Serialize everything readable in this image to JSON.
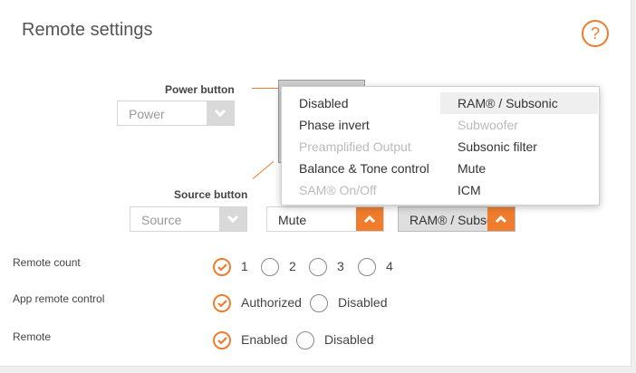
{
  "page": {
    "title": "Remote settings",
    "help_glyph": "?"
  },
  "colors": {
    "accent": "#f07c2e",
    "panel": "#ffffff",
    "border": "#d5d5d5"
  },
  "power": {
    "label": "Power button",
    "select_value": "Power"
  },
  "source": {
    "label": "Source button",
    "select_value": "Source",
    "mute_value": "Mute",
    "ram_value": "RAM® / Subsonic"
  },
  "dropdown": {
    "left_items": [
      {
        "label": "Disabled",
        "disabled": false
      },
      {
        "label": "Phase invert",
        "disabled": false
      },
      {
        "label": "Preamplified Output",
        "disabled": true
      },
      {
        "label": "Balance & Tone control",
        "disabled": false
      },
      {
        "label": "SAM® On/Off",
        "disabled": true
      }
    ],
    "right_items": [
      {
        "label": "RAM® / Subsonic",
        "disabled": false,
        "selected": true
      },
      {
        "label": "Subwoofer",
        "disabled": true
      },
      {
        "label": "Subsonic filter",
        "disabled": false
      },
      {
        "label": "Mute",
        "disabled": false
      },
      {
        "label": "ICM",
        "disabled": false
      }
    ]
  },
  "remote_count": {
    "label": "Remote count",
    "options": [
      "1",
      "2",
      "3",
      "4"
    ],
    "selected": "1"
  },
  "app_remote": {
    "label": "App remote control",
    "options": [
      "Authorized",
      "Disabled"
    ],
    "selected": "Authorized"
  },
  "remote": {
    "label": "Remote",
    "options": [
      "Enabled",
      "Disabled"
    ],
    "selected": "Enabled"
  }
}
